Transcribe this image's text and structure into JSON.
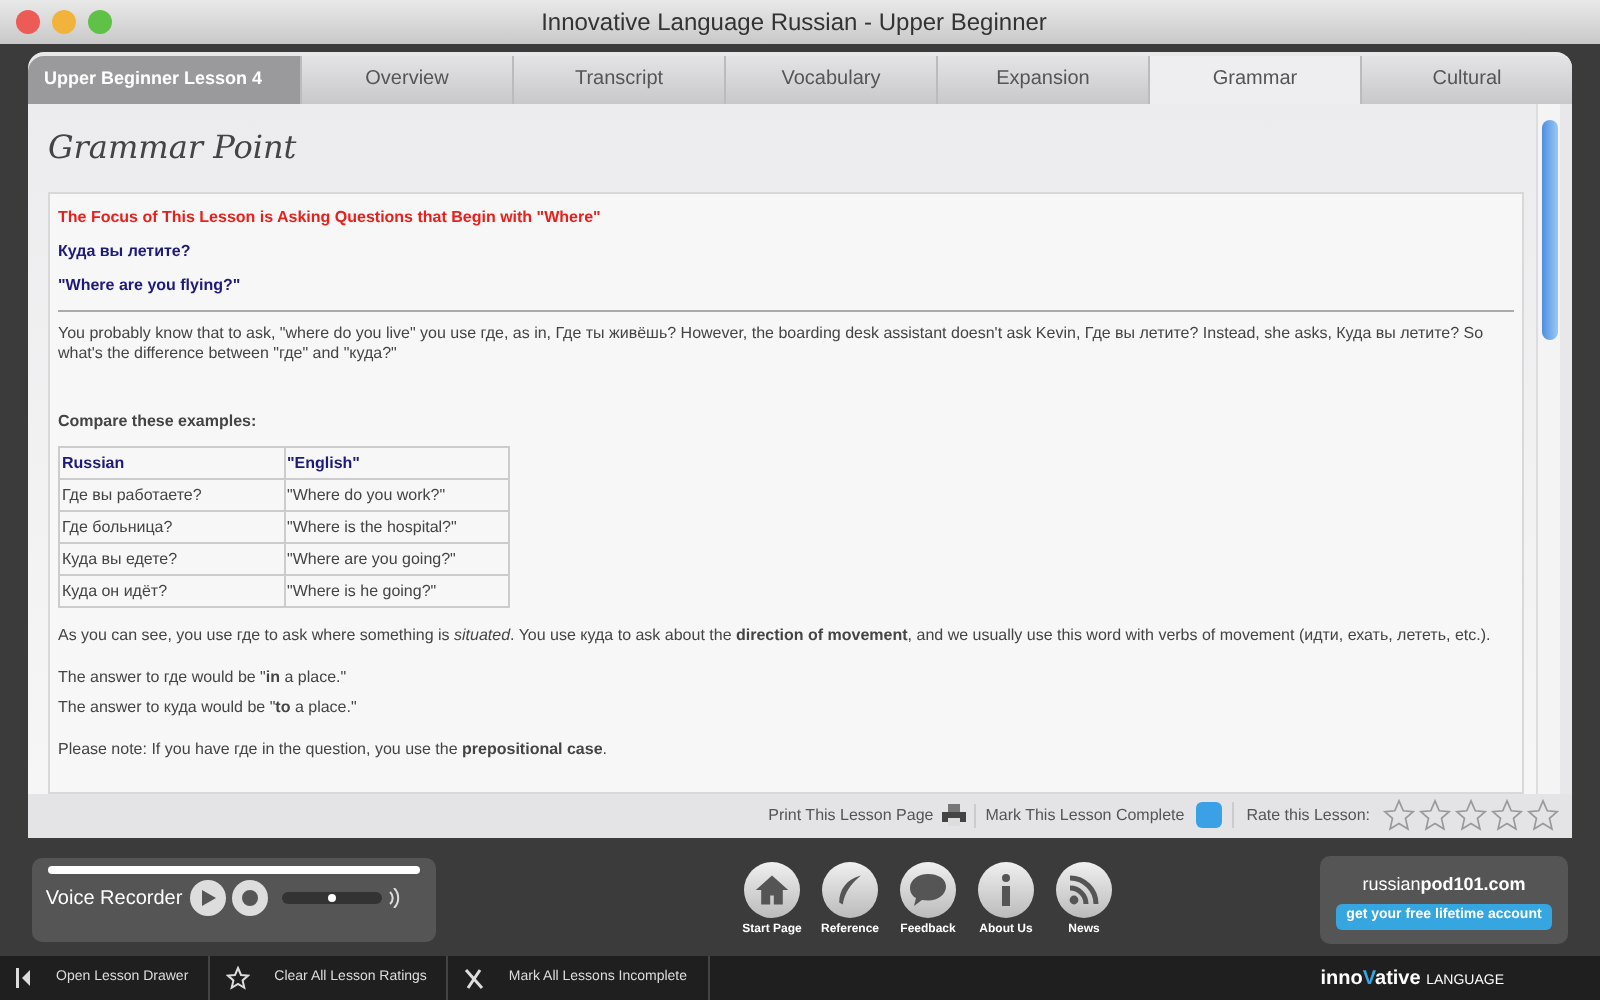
{
  "window": {
    "title": "Innovative Language Russian - Upper Beginner"
  },
  "lesson_label": "Upper Beginner Lesson 4",
  "tabs": [
    {
      "label": "Overview",
      "selected": false
    },
    {
      "label": "Transcript",
      "selected": false
    },
    {
      "label": "Vocabulary",
      "selected": false
    },
    {
      "label": "Expansion",
      "selected": false
    },
    {
      "label": "Grammar",
      "selected": true
    },
    {
      "label": "Cultural",
      "selected": false
    }
  ],
  "page_title": "Grammar Point",
  "focus": {
    "title": "The Focus of This Lesson is Asking Questions that Begin with \"Where\"",
    "phrase": "Куда вы летите?",
    "translation": "\"Where are you flying?\""
  },
  "intro": "You probably know that to ask, \"where do you live\" you use где, as in, Где ты живёшь? However, the boarding desk assistant doesn't ask Kevin, Где вы летите? Instead, she asks, Куда вы летите? So what's the difference between \"где\" and \"куда?\"",
  "compare_heading": "Compare these examples:",
  "table": {
    "columns": [
      "Russian",
      "\"English\""
    ],
    "rows": [
      [
        "Где вы работаете?",
        "\"Where do you work?\""
      ],
      [
        "Где больница?",
        "\"Where is the hospital?\""
      ],
      [
        "Куда вы едете?",
        "\"Where are you going?\""
      ],
      [
        "Куда он идёт?",
        "\"Where is he going?\""
      ]
    ]
  },
  "paragraphs": [
    "As you can see, you use где to ask where something is *situated*. You use куда to ask about the **direction of movement**, and we usually use this word with verbs of movement (идти, ехать, лететь, etc.).",
    "The answer to где would be \"**in** a place.\"",
    "The answer to куда would be \"**to** a place.\"",
    "Please note: If you have где in the question, you use the **prepositional case**."
  ],
  "lesson_footer": {
    "print": "Print This Lesson Page",
    "complete": "Mark This Lesson Complete",
    "checked": false,
    "rate": "Rate this Lesson:",
    "stars": 0
  },
  "voice_recorder": {
    "label": "Voice Recorder",
    "level": 0.5
  },
  "nav": [
    {
      "kind": "home",
      "label": "Start Page"
    },
    {
      "kind": "feather",
      "label": "Reference"
    },
    {
      "kind": "bubble",
      "label": "Feedback"
    },
    {
      "kind": "info",
      "label": "About Us"
    },
    {
      "kind": "rss",
      "label": "News"
    }
  ],
  "promo": {
    "site_prefix": "russian",
    "site_suffix": "pod101.com",
    "button": "get your free lifetime account"
  },
  "bottom_bar": [
    {
      "kind": "drawer",
      "label": "Open Lesson Drawer"
    },
    {
      "kind": "star",
      "label": "Clear All Lesson Ratings"
    },
    {
      "kind": "cross",
      "label": "Mark All Lessons Incomplete"
    }
  ],
  "brand": {
    "name_start": "inno",
    "name_v": "V",
    "name_end": "ative",
    "tagline": "LANGUAGE"
  }
}
